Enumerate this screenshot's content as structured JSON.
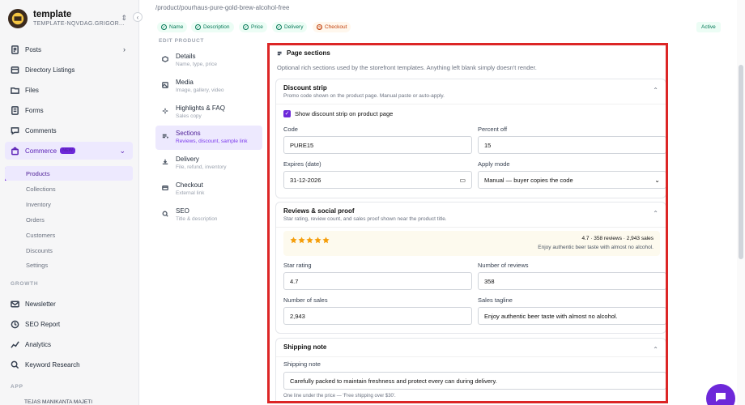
{
  "brand": {
    "name": "template",
    "subtitle": "TEMPLATE-NQVDAG.GRIGOR..."
  },
  "sidebar": {
    "nav": [
      {
        "label": "Posts",
        "icon": "posts-icon"
      },
      {
        "label": "Directory Listings",
        "icon": "directory-icon"
      },
      {
        "label": "Files",
        "icon": "folder-icon"
      },
      {
        "label": "Forms",
        "icon": "forms-icon"
      },
      {
        "label": "Comments",
        "icon": "comments-icon"
      },
      {
        "label": "Commerce",
        "icon": "bag-icon",
        "badge": "NEW"
      }
    ],
    "commerce_sub": [
      "Products",
      "Collections",
      "Inventory",
      "Orders",
      "Customers",
      "Discounts",
      "Settings"
    ],
    "growth_label": "GROWTH",
    "growth": [
      {
        "label": "Newsletter",
        "icon": "mail-icon"
      },
      {
        "label": "SEO Report",
        "icon": "report-icon"
      },
      {
        "label": "Analytics",
        "icon": "analytics-icon"
      },
      {
        "label": "Keyword Research",
        "icon": "search-icon"
      }
    ],
    "app_label": "APP",
    "footer_user": "TEJAS MANIKANTA MAJETI"
  },
  "header": {
    "path": "/product/pourhaus-pure-gold-brew-alcohol-free",
    "chips": [
      "Name",
      "Description",
      "Price",
      "Delivery",
      "Checkout"
    ],
    "status": "Active"
  },
  "edit_menu": {
    "label": "EDIT PRODUCT",
    "items": [
      {
        "title": "Details",
        "sub": "Name, type, price"
      },
      {
        "title": "Media",
        "sub": "Image, gallery, video"
      },
      {
        "title": "Highlights & FAQ",
        "sub": "Sales copy"
      },
      {
        "title": "Sections",
        "sub": "Reviews, discount, sample link"
      },
      {
        "title": "Delivery",
        "sub": "File, refund, inventory"
      },
      {
        "title": "Checkout",
        "sub": "External link"
      },
      {
        "title": "SEO",
        "sub": "Title & description"
      }
    ]
  },
  "panel": {
    "title": "Page sections",
    "description": "Optional rich sections used by the storefront templates. Anything left blank simply doesn't render."
  },
  "discount": {
    "title": "Discount strip",
    "subtitle": "Promo code shown on the product page. Manual paste or auto-apply.",
    "show_label": "Show discount strip on product page",
    "code_label": "Code",
    "code_value": "PURE15",
    "percent_label": "Percent off",
    "percent_value": "15",
    "expires_label": "Expires (date)",
    "expires_value": "31-12-2026",
    "mode_label": "Apply mode",
    "mode_value": "Manual — buyer copies the code"
  },
  "reviews": {
    "title": "Reviews & social proof",
    "subtitle": "Star rating, review count, and sales proof shown near the product title.",
    "preview_stars": 4.7,
    "preview_meta": "4.7 · 358 reviews · 2,943 sales",
    "preview_tagline": "Enjoy authentic beer taste with almost no alcohol.",
    "rating_label": "Star rating",
    "rating_value": "4.7",
    "count_label": "Number of reviews",
    "count_value": "358",
    "sales_label": "Number of sales",
    "sales_value": "2,943",
    "tagline_label": "Sales tagline",
    "tagline_value": "Enjoy authentic beer taste with almost no alcohol."
  },
  "shipping": {
    "title": "Shipping note",
    "label": "Shipping note",
    "value": "Carefully packed to maintain freshness and protect every can during delivery.",
    "hint": "One line under the price — 'Free shipping over $30'."
  },
  "colors": {
    "accent": "#6d28d9",
    "highlight": "#dc2626",
    "success": "#047857",
    "warning": "#c2410c",
    "star": "#f59e0b"
  }
}
